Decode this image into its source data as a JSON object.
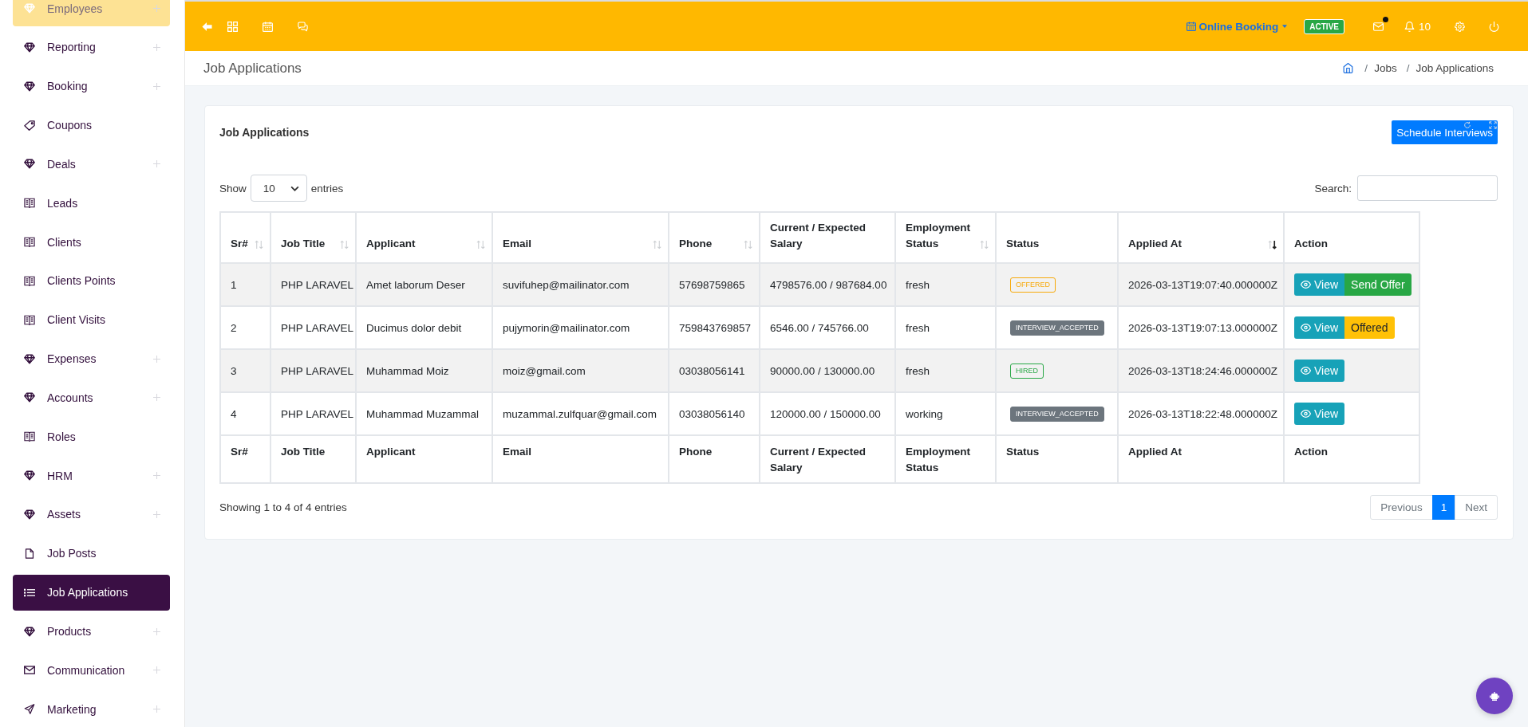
{
  "sidebar": {
    "items": [
      {
        "label": "Employees",
        "kind": "gem",
        "expandable": true,
        "highlighted": true,
        "selected": false
      },
      {
        "label": "Reporting",
        "kind": "gem",
        "expandable": true,
        "highlighted": false,
        "selected": false
      },
      {
        "label": "Booking",
        "kind": "gem",
        "expandable": true,
        "highlighted": false,
        "selected": false
      },
      {
        "label": "Coupons",
        "kind": "tag",
        "expandable": false,
        "highlighted": false,
        "selected": false
      },
      {
        "label": "Deals",
        "kind": "gem",
        "expandable": true,
        "highlighted": false,
        "selected": false
      },
      {
        "label": "Leads",
        "kind": "book",
        "expandable": false,
        "highlighted": false,
        "selected": false
      },
      {
        "label": "Clients",
        "kind": "book",
        "expandable": false,
        "highlighted": false,
        "selected": false
      },
      {
        "label": "Clients Points",
        "kind": "book",
        "expandable": false,
        "highlighted": false,
        "selected": false
      },
      {
        "label": "Client Visits",
        "kind": "book",
        "expandable": false,
        "highlighted": false,
        "selected": false
      },
      {
        "label": "Expenses",
        "kind": "gem",
        "expandable": true,
        "highlighted": false,
        "selected": false
      },
      {
        "label": "Accounts",
        "kind": "gem",
        "expandable": true,
        "highlighted": false,
        "selected": false
      },
      {
        "label": "Roles",
        "kind": "book",
        "expandable": false,
        "highlighted": false,
        "selected": false
      },
      {
        "label": "HRM",
        "kind": "gem",
        "expandable": true,
        "highlighted": false,
        "selected": false
      },
      {
        "label": "Assets",
        "kind": "gem",
        "expandable": true,
        "highlighted": false,
        "selected": false
      },
      {
        "label": "Job Posts",
        "kind": "file",
        "expandable": false,
        "highlighted": false,
        "selected": false
      },
      {
        "label": "Job Applications",
        "kind": "list",
        "expandable": false,
        "highlighted": false,
        "selected": true
      },
      {
        "label": "Products",
        "kind": "gem",
        "expandable": true,
        "highlighted": false,
        "selected": false
      },
      {
        "label": "Communication",
        "kind": "mail",
        "expandable": true,
        "highlighted": false,
        "selected": false
      },
      {
        "label": "Marketing",
        "kind": "send",
        "expandable": true,
        "highlighted": false,
        "selected": false
      }
    ]
  },
  "topbar": {
    "booking_menu": "Online Booking",
    "status_badge": "ACTIVE",
    "mail": {
      "unread": true
    },
    "notifications": {
      "count": "10"
    }
  },
  "page_header": {
    "title": "Job Applications",
    "breadcrumb": [
      {
        "separator": "/",
        "label": "Jobs"
      },
      {
        "separator": "/",
        "label": "Job Applications"
      }
    ]
  },
  "card": {
    "title": "Job Applications",
    "button": "Schedule Interviews",
    "length": {
      "label_before": "Show",
      "value": "10",
      "label_after": "entries"
    },
    "search": {
      "label": "Search:"
    },
    "table": {
      "columns": [
        {
          "label": "Sr#",
          "sortable": true,
          "sorted_descending": false
        },
        {
          "label": "Job Title",
          "sortable": true,
          "sorted_descending": false
        },
        {
          "label": "Applicant",
          "sortable": true,
          "sorted_descending": false
        },
        {
          "label": "Email",
          "sortable": true,
          "sorted_descending": false
        },
        {
          "label": "Phone",
          "sortable": true,
          "sorted_descending": false
        },
        {
          "label": "Current / Expected Salary",
          "sortable": false,
          "sorted_descending": false
        },
        {
          "label": "Employment Status",
          "sortable": true,
          "sorted_descending": false
        },
        {
          "label": "Status",
          "sortable": false,
          "sorted_descending": false
        },
        {
          "label": "Applied At",
          "sortable": true,
          "sorted_descending": true
        },
        {
          "label": "Action",
          "sortable": false,
          "sorted_descending": false
        }
      ],
      "rows": [
        {
          "sr": "1",
          "job_title": "PHP LARAVEL",
          "applicant": "Amet laborum Deser",
          "email": "suvifuhep@mailinator.com",
          "phone": "57698759865",
          "salary": "4798576.00 / 987684.00",
          "employment_status": "fresh",
          "status": {
            "label": "OFFERED",
            "kind": "outline",
            "color": "#f7a90a"
          },
          "applied_at": "2026-03-13T19:07:40.000000Z",
          "actions": [
            {
              "label": "View",
              "kind": "info"
            },
            {
              "label": "Send Offer",
              "kind": "success"
            }
          ]
        },
        {
          "sr": "2",
          "job_title": "PHP LARAVEL",
          "applicant": "Ducimus dolor debit",
          "email": "pujymorin@mailinator.com",
          "phone": "759843769857",
          "salary": "6546.00 / 745766.00",
          "employment_status": "fresh",
          "status": {
            "label": "INTERVIEW_ACCEPTED",
            "kind": "solid",
            "color": "#6c757d"
          },
          "applied_at": "2026-03-13T19:07:13.000000Z",
          "actions": [
            {
              "label": "View",
              "kind": "info"
            },
            {
              "label": "Offered",
              "kind": "warning"
            }
          ]
        },
        {
          "sr": "3",
          "job_title": "PHP LARAVEL",
          "applicant": "Muhammad Moiz",
          "email": "moiz@gmail.com",
          "phone": "03038056141",
          "salary": "90000.00 / 130000.00",
          "employment_status": "fresh",
          "status": {
            "label": "HIRED",
            "kind": "outline",
            "color": "#28a745"
          },
          "applied_at": "2026-03-13T18:24:46.000000Z",
          "actions": [
            {
              "label": "View",
              "kind": "info"
            }
          ]
        },
        {
          "sr": "4",
          "job_title": "PHP LARAVEL",
          "applicant": "Muhammad Muzammal",
          "email": "muzammal.zulfquar@gmail.com",
          "phone": "03038056140",
          "salary": "120000.00 / 150000.00",
          "employment_status": "working",
          "status": {
            "label": "INTERVIEW_ACCEPTED",
            "kind": "solid",
            "color": "#6c757d"
          },
          "applied_at": "2026-03-13T18:22:48.000000Z",
          "actions": [
            {
              "label": "View",
              "kind": "info"
            }
          ]
        }
      ],
      "footer_columns": [
        "Sr#",
        "Job Title",
        "Applicant",
        "Email",
        "Phone",
        "Current / Expected Salary",
        "Employment Status",
        "Status",
        "Applied At",
        "Action"
      ]
    },
    "info": "Showing 1 to 4 of 4 entries",
    "pagination": [
      {
        "label": "Previous",
        "selected": false,
        "disabled": true
      },
      {
        "label": "1",
        "selected": true,
        "disabled": false
      },
      {
        "label": "Next",
        "selected": false,
        "disabled": true
      }
    ]
  }
}
